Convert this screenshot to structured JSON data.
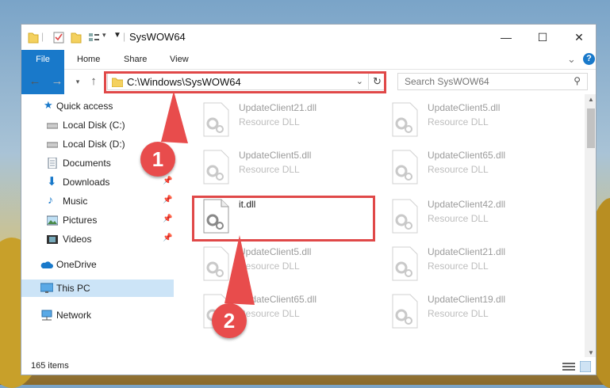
{
  "window": {
    "title": "SysWOW64",
    "controls": {
      "minimize_glyph": "—",
      "maximize_glyph": "☐",
      "close_glyph": "✕"
    }
  },
  "ribbon": {
    "tabs": [
      {
        "label": "File"
      },
      {
        "label": "Home"
      },
      {
        "label": "Share"
      },
      {
        "label": "View"
      }
    ],
    "help_glyph": "?",
    "expand_glyph": "⌄"
  },
  "address_bar": {
    "path": "C:\\Windows\\SysWOW64",
    "search_placeholder": "Search SysWOW64"
  },
  "sidebar": {
    "items": [
      {
        "label": "Quick access",
        "icon": "star-icon",
        "pinned": false
      },
      {
        "label": "Local Disk (C:)",
        "icon": "drive-icon",
        "pinned": false
      },
      {
        "label": "Local Disk (D:)",
        "icon": "drive-icon",
        "pinned": false
      },
      {
        "label": "Documents",
        "icon": "documents-icon",
        "pinned": true
      },
      {
        "label": "Downloads",
        "icon": "download-arrow-icon",
        "pinned": true
      },
      {
        "label": "Music",
        "icon": "music-note-icon",
        "pinned": true
      },
      {
        "label": "Pictures",
        "icon": "pictures-icon",
        "pinned": true
      },
      {
        "label": "Videos",
        "icon": "film-icon",
        "pinned": true
      },
      {
        "label": "OneDrive",
        "icon": "cloud-icon",
        "pinned": false
      },
      {
        "label": "This PC",
        "icon": "monitor-icon",
        "pinned": false,
        "selected": true
      },
      {
        "label": "Network",
        "icon": "network-icon",
        "pinned": false
      }
    ]
  },
  "files": [
    {
      "name": "UpdateClient21.dll",
      "type": "Resource DLL",
      "faded": true
    },
    {
      "name": "UpdateClient5.dll",
      "type": "Resource DLL",
      "faded": true
    },
    {
      "name": "UpdateClient5.dll",
      "type": "Resource DLL",
      "faded": true
    },
    {
      "name": "UpdateClient65.dll",
      "type": "Resource DLL",
      "faded": true
    },
    {
      "name": "it.dll",
      "type": "",
      "faded": false,
      "highlighted": true
    },
    {
      "name": "UpdateClient42.dll",
      "type": "Resource DLL",
      "faded": true
    },
    {
      "name": "UpdateClient5.dll",
      "type": "Resource DLL",
      "faded": true
    },
    {
      "name": "UpdateClient21.dll",
      "type": "Resource DLL",
      "faded": true
    },
    {
      "name": "UpdateClient65.dll",
      "type": "Resource DLL",
      "faded": true
    },
    {
      "name": "UpdateClient19.dll",
      "type": "Resource DLL",
      "faded": true
    }
  ],
  "status_bar": {
    "item_count": "165 items"
  },
  "annotations": {
    "step1": "1",
    "step2": "2",
    "color": "#e04848"
  }
}
